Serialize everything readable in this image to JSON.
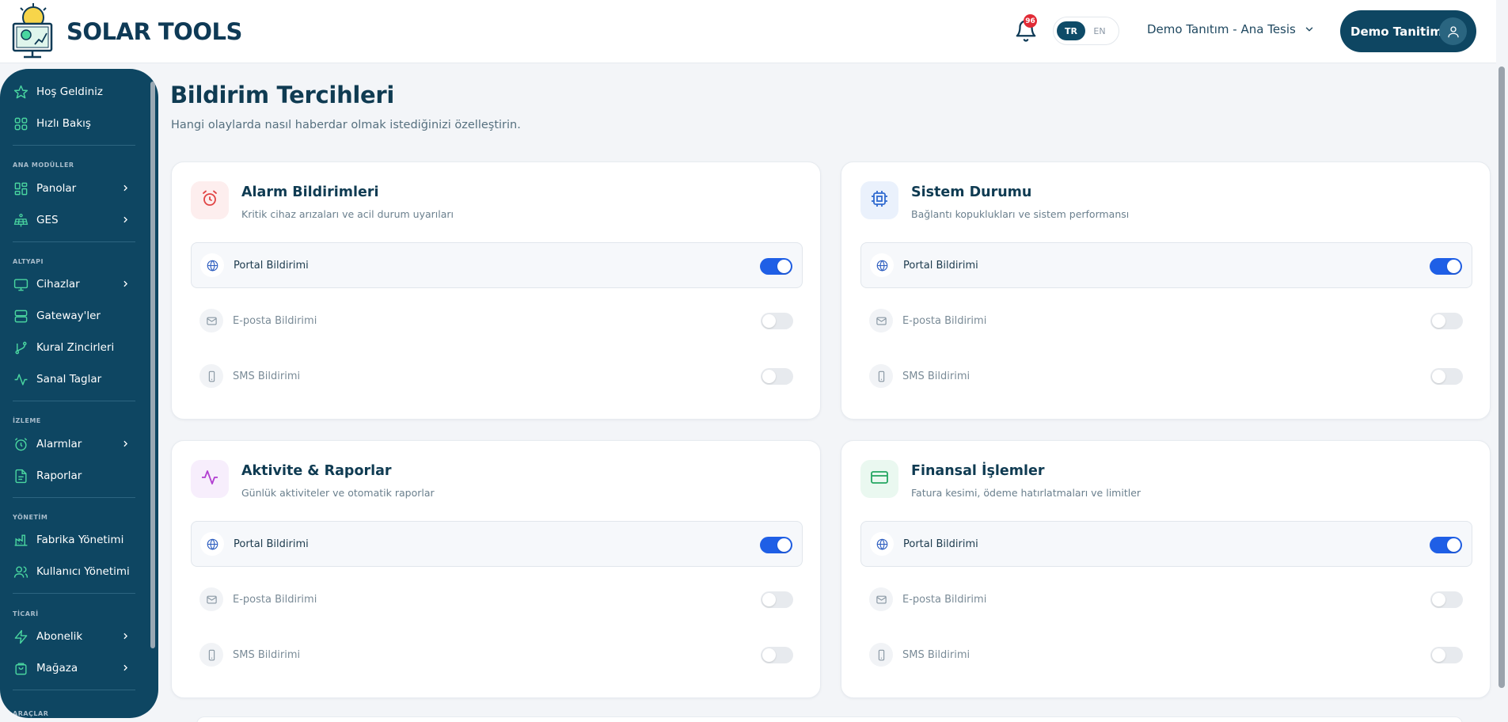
{
  "app": {
    "name": "SOLAR TOOLS"
  },
  "header": {
    "notifications": {
      "count": "96"
    },
    "language": {
      "active": "TR",
      "inactive": "EN"
    },
    "site": "Demo Tanıtım - Ana Tesis",
    "user": "Demo Tanitim"
  },
  "sidebar": {
    "top": [
      {
        "label": "Hoş Geldiniz",
        "icon": "star-icon"
      },
      {
        "label": "Hızlı Bakış",
        "icon": "grid-icon"
      }
    ],
    "sections": [
      {
        "title": "ANA MODÜLLER",
        "items": [
          {
            "label": "Panolar",
            "icon": "dashboard-icon",
            "chevron": true
          },
          {
            "label": "GES",
            "icon": "solar-panel-icon",
            "chevron": true
          }
        ]
      },
      {
        "title": "ALTYAPI",
        "items": [
          {
            "label": "Cihazlar",
            "icon": "monitor-icon",
            "chevron": true
          },
          {
            "label": "Gateway'ler",
            "icon": "server-icon",
            "chevron": false
          },
          {
            "label": "Kural Zincirleri",
            "icon": "branch-icon",
            "chevron": false
          },
          {
            "label": "Sanal Taglar",
            "icon": "activity-icon",
            "chevron": false
          }
        ]
      },
      {
        "title": "İZLEME",
        "items": [
          {
            "label": "Alarmlar",
            "icon": "alarm-icon",
            "chevron": true
          },
          {
            "label": "Raporlar",
            "icon": "report-icon",
            "chevron": false
          }
        ]
      },
      {
        "title": "YÖNETİM",
        "items": [
          {
            "label": "Fabrika Yönetimi",
            "icon": "factory-icon",
            "chevron": false
          },
          {
            "label": "Kullanıcı Yönetimi",
            "icon": "users-icon",
            "chevron": false
          }
        ]
      },
      {
        "title": "TİCARİ",
        "items": [
          {
            "label": "Abonelik",
            "icon": "bolt-icon",
            "chevron": true
          },
          {
            "label": "Mağaza",
            "icon": "shopping-bag-icon",
            "chevron": true
          }
        ]
      },
      {
        "title": "ARAÇLAR",
        "items": []
      }
    ]
  },
  "page": {
    "title": "Bildirim Tercihleri",
    "subtitle": "Hangi olaylarda nasıl haberdar olmak istediğinizi özelleştirin."
  },
  "cards": [
    {
      "title": "Alarm Bildirimleri",
      "desc": "Kritik cihaz arızaları ve acil durum uyarıları",
      "icon": "alarm-clock-icon",
      "icon_color": "#e14545",
      "icon_bg": "#fdeeee",
      "channels": [
        {
          "label": "Portal Bildirimi",
          "icon": "globe-icon",
          "enabled": true
        },
        {
          "label": "E-posta Bildirimi",
          "icon": "mail-icon",
          "enabled": false
        },
        {
          "label": "SMS Bildirimi",
          "icon": "phone-icon",
          "enabled": false
        }
      ]
    },
    {
      "title": "Sistem Durumu",
      "desc": "Bağlantı kopuklukları ve sistem performansı",
      "icon": "cpu-icon",
      "icon_color": "#2f6ad0",
      "icon_bg": "#eaf1fc",
      "channels": [
        {
          "label": "Portal Bildirimi",
          "icon": "globe-icon",
          "enabled": true
        },
        {
          "label": "E-posta Bildirimi",
          "icon": "mail-icon",
          "enabled": false
        },
        {
          "label": "SMS Bildirimi",
          "icon": "phone-icon",
          "enabled": false
        }
      ]
    },
    {
      "title": "Aktivite & Raporlar",
      "desc": "Günlük aktiviteler ve otomatik raporlar",
      "icon": "activity-icon",
      "icon_color": "#b23fd1",
      "icon_bg": "#f7eefc",
      "channels": [
        {
          "label": "Portal Bildirimi",
          "icon": "globe-icon",
          "enabled": true
        },
        {
          "label": "E-posta Bildirimi",
          "icon": "mail-icon",
          "enabled": false
        },
        {
          "label": "SMS Bildirimi",
          "icon": "phone-icon",
          "enabled": false
        }
      ]
    },
    {
      "title": "Finansal İşlemler",
      "desc": "Fatura kesimi, ödeme hatırlatmaları ve limitler",
      "icon": "credit-card-icon",
      "icon_color": "#24a561",
      "icon_bg": "#eaf8f0",
      "channels": [
        {
          "label": "Portal Bildirimi",
          "icon": "globe-icon",
          "enabled": true
        },
        {
          "label": "E-posta Bildirimi",
          "icon": "mail-icon",
          "enabled": false
        },
        {
          "label": "SMS Bildirimi",
          "icon": "phone-icon",
          "enabled": false
        }
      ]
    }
  ],
  "colors": {
    "primary": "#0e4662",
    "toggle_on": "#1f5fe6",
    "accent_icon": "#4ad6a0"
  }
}
